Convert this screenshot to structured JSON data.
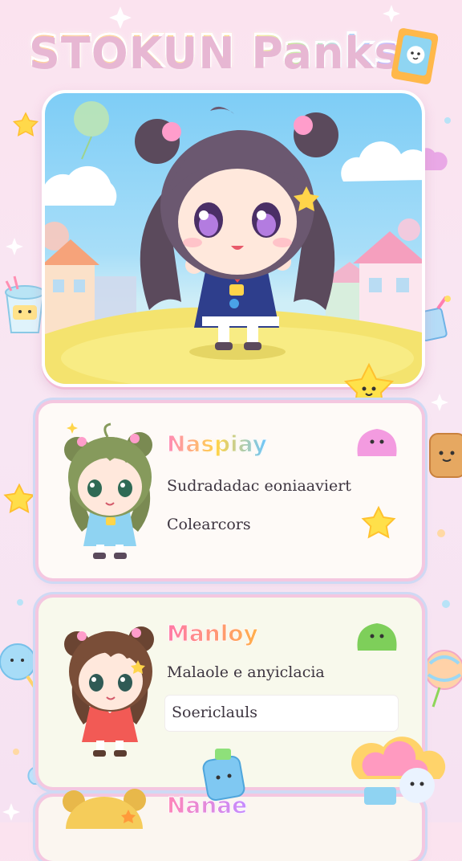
{
  "title": {
    "part1": "STOKUN",
    "part2": "Panks"
  },
  "characters": [
    {
      "name": "Naspiay",
      "line1": "Sudradadac eoniaaviert",
      "line2": "Colearcors"
    },
    {
      "name": "Manloy",
      "line1": "Malaole e anyiclacia",
      "line2": "Soericlauls"
    },
    {
      "name": "Nanae"
    }
  ],
  "icons": [
    "sparkle-icon",
    "star-icon",
    "cloud-icon",
    "ice-cream-cup-icon",
    "slime-icon",
    "lollipop-icon",
    "balloon-icon",
    "picture-frame-icon"
  ]
}
